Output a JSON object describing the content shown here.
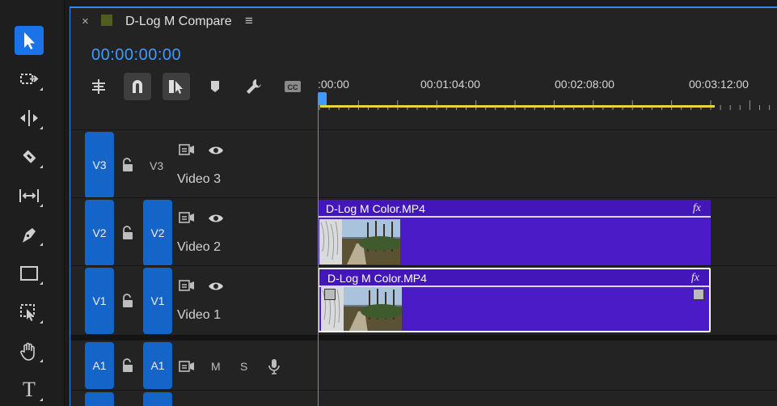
{
  "tools": [
    {
      "name": "selection-tool",
      "icon": "arrow-cursor-icon",
      "active": true
    },
    {
      "name": "track-select-tool",
      "icon": "track-select-icon"
    },
    {
      "name": "ripple-edit-tool",
      "icon": "ripple-edit-icon"
    },
    {
      "name": "razor-tool",
      "icon": "razor-icon"
    },
    {
      "name": "slip-tool",
      "icon": "slip-icon"
    },
    {
      "name": "pen-tool",
      "icon": "pen-icon"
    },
    {
      "name": "rectangle-tool",
      "icon": "rectangle-icon"
    },
    {
      "name": "zoom-select-tool",
      "icon": "zoom-select-icon"
    },
    {
      "name": "hand-tool",
      "icon": "hand-icon"
    },
    {
      "name": "type-tool",
      "icon": "type-icon",
      "glyph": "T"
    }
  ],
  "sequence": {
    "close": "×",
    "title": "D-Log M Compare",
    "menu": "≡",
    "timecode": "00:00:00:00",
    "swatch_color": "#4f5e1c"
  },
  "ruler": {
    "labels": [
      ":00:00",
      "00:01:04:00",
      "00:02:08:00",
      "00:03:12:00"
    ],
    "playhead_color": "#3f9bff",
    "workarea_color": "#e2d73a"
  },
  "tracks": {
    "v3": {
      "target": "V3",
      "name": "V3",
      "label": "Video 3"
    },
    "v2": {
      "target": "V2",
      "source": "V2",
      "label": "Video 2"
    },
    "v1": {
      "target": "V1",
      "source": "V1",
      "label": "Video 1"
    },
    "a1": {
      "target": "A1",
      "source": "A1",
      "mute": "M",
      "solo": "S"
    },
    "a2": {
      "target": "",
      "source": ""
    }
  },
  "clips": {
    "v2_clip": {
      "name": "D-Log M Color.MP4",
      "fx": "fx"
    },
    "v1_clip": {
      "name": "D-Log M Color.MP4",
      "fx": "fx"
    }
  },
  "colors": {
    "accent": "#1565c8",
    "clip": "#4a1bc6"
  }
}
